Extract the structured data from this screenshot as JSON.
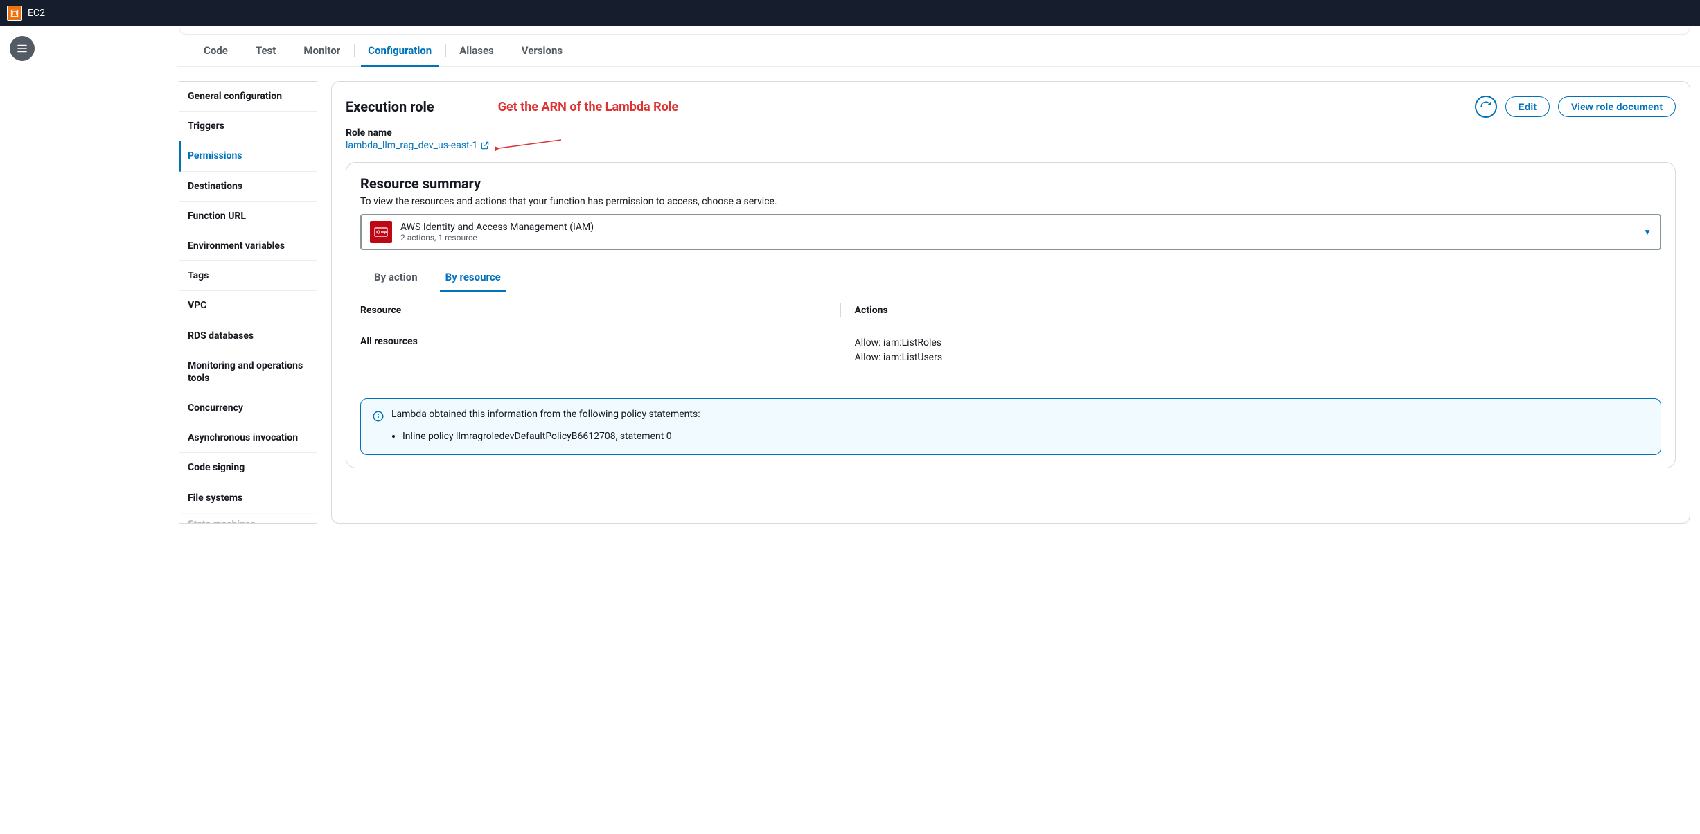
{
  "topbar": {
    "service": "EC2"
  },
  "tabs": [
    "Code",
    "Test",
    "Monitor",
    "Configuration",
    "Aliases",
    "Versions"
  ],
  "activeTab": "Configuration",
  "sidenav": [
    "General configuration",
    "Triggers",
    "Permissions",
    "Destinations",
    "Function URL",
    "Environment variables",
    "Tags",
    "VPC",
    "RDS databases",
    "Monitoring and operations tools",
    "Concurrency",
    "Asynchronous invocation",
    "Code signing",
    "File systems",
    "State machines"
  ],
  "sidenavSelected": "Permissions",
  "execRole": {
    "heading": "Execution role",
    "annotation": "Get the ARN of the Lambda Role",
    "roleNameLabel": "Role name",
    "roleName": "lambda_llm_rag_dev_us-east-1",
    "editBtn": "Edit",
    "viewBtn": "View role document"
  },
  "resourceSummary": {
    "heading": "Resource summary",
    "desc": "To view the resources and actions that your function has permission to access, choose a service.",
    "serviceName": "AWS Identity and Access Management (IAM)",
    "serviceSub": "2 actions, 1 resource",
    "subtabs": [
      "By action",
      "By resource"
    ],
    "subtabActive": "By resource",
    "colResource": "Resource",
    "colActions": "Actions",
    "rowResource": "All resources",
    "rowActions": [
      "Allow: iam:ListRoles",
      "Allow: iam:ListUsers"
    ],
    "infoText": "Lambda obtained this information from the following policy statements:",
    "infoItems": [
      "Inline policy llmragroledevDefaultPolicyB6612708, statement 0"
    ]
  }
}
